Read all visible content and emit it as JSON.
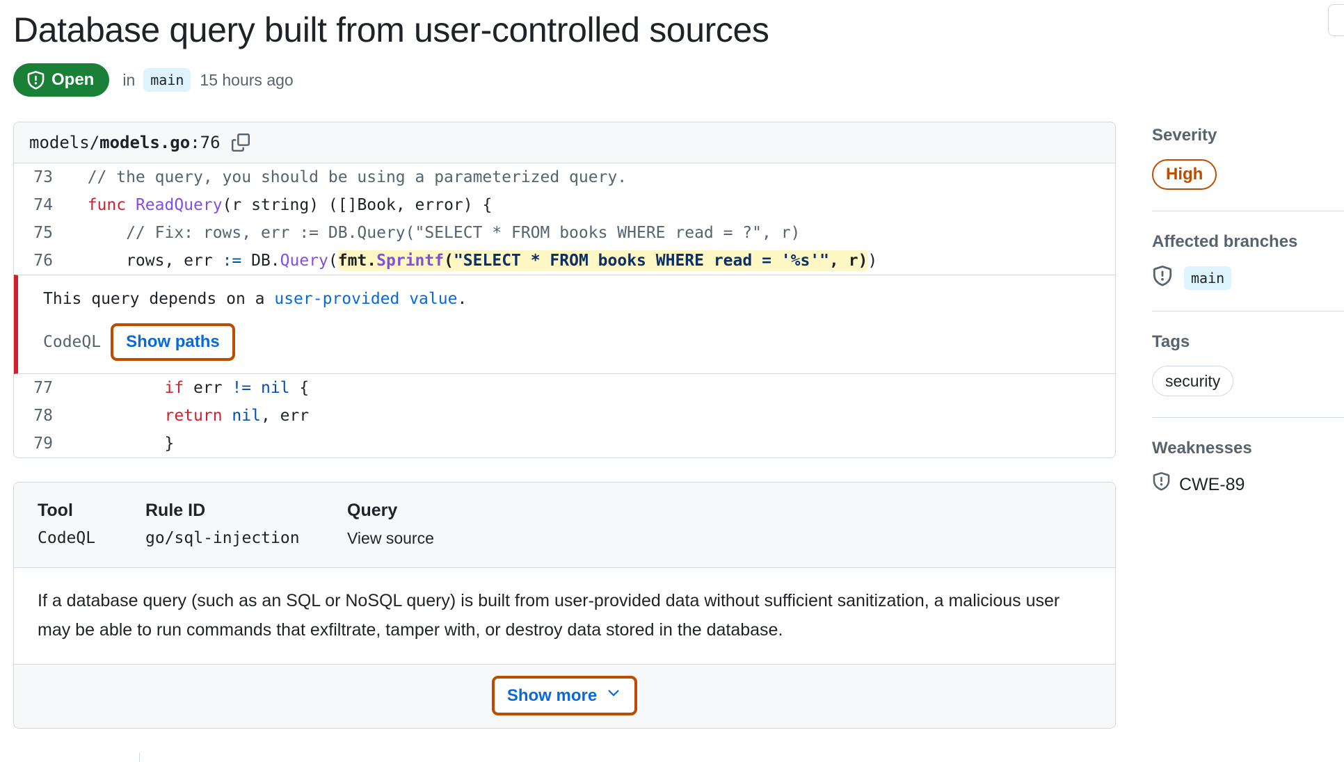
{
  "header": {
    "title": "Database query built from user-controlled sources",
    "state_label": "Open",
    "state_icon": "shield-exclamation-icon",
    "state_color": "#1a7f37",
    "in_label": "in",
    "branch": "main",
    "timestamp": "15 hours ago"
  },
  "corner": {
    "button_name": "partially-visible-button"
  },
  "code": {
    "path_dir": "models/",
    "path_file": "models.go",
    "path_line": ":76",
    "copy_icon": "copy-icon",
    "lines": [
      {
        "num": "73",
        "kind": "comment",
        "text": "  // the query, you should be using a parameterized query."
      },
      {
        "num": "74",
        "kind": "func_decl",
        "text": "  func ReadQuery(r string) ([]Book, error) {"
      },
      {
        "num": "75",
        "kind": "comment",
        "text": "      // Fix: rows, err := DB.Query(\"SELECT * FROM books WHERE read = ?\", r)"
      },
      {
        "num": "76",
        "kind": "highlighted",
        "text": "      rows, err := DB.Query(fmt.Sprintf(\"SELECT * FROM books WHERE read = '%s'\", r))"
      },
      {
        "num": "77",
        "kind": "plain",
        "text": "          if err != nil {"
      },
      {
        "num": "78",
        "kind": "plain",
        "text": "              return nil, err"
      },
      {
        "num": "79",
        "kind": "plain",
        "text": "          }"
      }
    ],
    "line76": {
      "prefix": "      rows, err ",
      "assign": ":=",
      "db": " DB.",
      "query": "Query",
      "open_paren": "(",
      "hl_fmt": "fmt.",
      "hl_sprintf": "Sprintf",
      "hl_paren": "(",
      "hl_string": "\"SELECT * FROM books WHERE read = '%s'\"",
      "hl_comma_r": ", r)",
      "tail": ")"
    },
    "line73": {
      "text": "  // the query, you should be using a parameterized query."
    },
    "line74": {
      "kw": "func",
      "fn": " ReadQuery",
      "rest": "(r string) ([]Book, error) {"
    },
    "line75": {
      "text": "      // Fix: rows, err := DB.Query(\"SELECT * FROM books WHERE read = ?\", r)"
    },
    "line77": {
      "kw": "if",
      "mid": " err ",
      "op": "!=",
      "nil": " nil",
      "tail": " {"
    },
    "line78": {
      "indent": "          ",
      "kw": "return",
      "nil": " nil",
      "tail": ", err"
    },
    "line79": {
      "text": "          }"
    }
  },
  "alert": {
    "text_before": "This query depends on a ",
    "link_text": "user-provided value",
    "text_after": ".",
    "tool": "CodeQL",
    "show_paths_label": "Show paths"
  },
  "details": {
    "columns": [
      {
        "label": "Tool",
        "value": "CodeQL",
        "mono": true
      },
      {
        "label": "Rule ID",
        "value": "go/sql-injection",
        "mono": true
      },
      {
        "label": "Query",
        "value": "View source",
        "mono": false
      }
    ],
    "description": "If a database query (such as an SQL or NoSQL query) is built from user-provided data without sufficient sanitization, a malicious user may be able to run commands that exfiltrate, tamper with, or destroy data stored in the database.",
    "show_more_label": "Show more",
    "show_more_icon": "chevron-down-icon"
  },
  "sidebar": {
    "severity": {
      "title": "Severity",
      "value": "High",
      "color": "#bc4c00"
    },
    "affected_branches": {
      "title": "Affected branches",
      "icon": "shield-exclamation-icon",
      "branch": "main"
    },
    "tags": {
      "title": "Tags",
      "items": [
        "security"
      ]
    },
    "weaknesses": {
      "title": "Weaknesses",
      "icon": "shield-exclamation-icon",
      "items": [
        "CWE-89"
      ]
    }
  }
}
